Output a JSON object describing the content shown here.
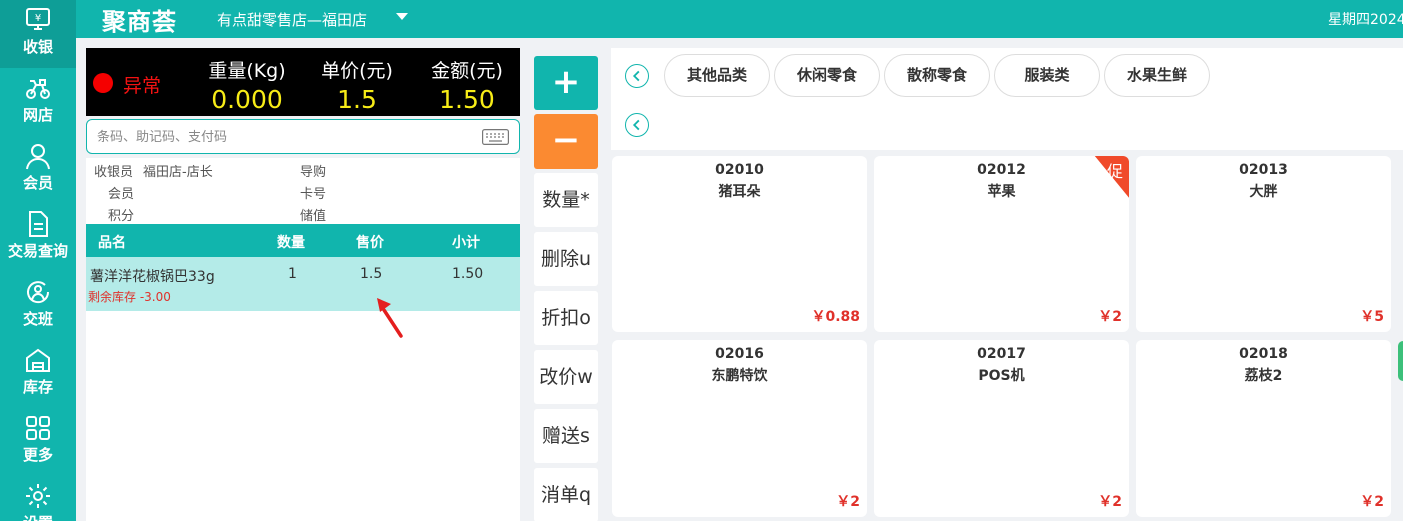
{
  "app": {
    "logo": "聚商荟",
    "store": "有点甜零售店—福田店",
    "weekday": "星期四2024"
  },
  "sidebar": {
    "items": [
      {
        "label": "收银",
        "icon": "cashier-icon"
      },
      {
        "label": "网店",
        "icon": "delivery-bike-icon"
      },
      {
        "label": "会员",
        "icon": "member-icon"
      },
      {
        "label": "交易查询",
        "icon": "document-icon"
      },
      {
        "label": "交班",
        "icon": "shift-change-icon"
      },
      {
        "label": "库存",
        "icon": "warehouse-icon"
      },
      {
        "label": "更多",
        "icon": "grid-icon"
      },
      {
        "label": "设置",
        "icon": "gear-icon"
      }
    ]
  },
  "display": {
    "status": "异常",
    "weight_label": "重量(Kg)",
    "weight": "0.000",
    "unit_price_label": "单价(元)",
    "unit_price": "1.5",
    "amount_label": "金额(元)",
    "amount": "1.50"
  },
  "search": {
    "placeholder": "条码、助记码、支付码"
  },
  "info": {
    "cashier_label": "收银员",
    "cashier": "福田店-店长",
    "guide_label": "导购",
    "member_label": "会员",
    "card_label": "卡号",
    "points_label": "积分",
    "stored_label": "储值"
  },
  "cart": {
    "headers": {
      "name": "品名",
      "qty": "数量",
      "price": "售价",
      "subtotal": "小计"
    },
    "rows": [
      {
        "name": "薯洋洋花椒锅巴33g",
        "qty": "1",
        "price": "1.5",
        "subtotal": "1.50",
        "stock": "剩余库存 -3.00"
      }
    ]
  },
  "actions": {
    "plus": "+",
    "minus": "−",
    "quantity": "数量*",
    "delete": "删除u",
    "discount": "折扣o",
    "change_price": "改价w",
    "gift": "赠送s",
    "cancel": "消单q"
  },
  "categories": [
    "其他品类",
    "休闲零食",
    "散称零食",
    "服装类",
    "水果生鲜"
  ],
  "products": [
    {
      "code": "02010",
      "name": "猪耳朵",
      "price": "￥0.88"
    },
    {
      "code": "02012",
      "name": "苹果",
      "price": "￥2",
      "badge": "促"
    },
    {
      "code": "02013",
      "name": "大胖",
      "price": "￥5"
    },
    {
      "code": "02016",
      "name": "东鹏特饮",
      "price": "￥2"
    },
    {
      "code": "02017",
      "name": "POS机",
      "price": "￥2"
    },
    {
      "code": "02018",
      "name": "荔枝2",
      "price": "￥2"
    }
  ],
  "colors": {
    "brand": "#11b5ad",
    "accent": "#fb8a31",
    "price": "#e0312a",
    "lcd": "#f7ec17",
    "alert": "#f50000"
  }
}
